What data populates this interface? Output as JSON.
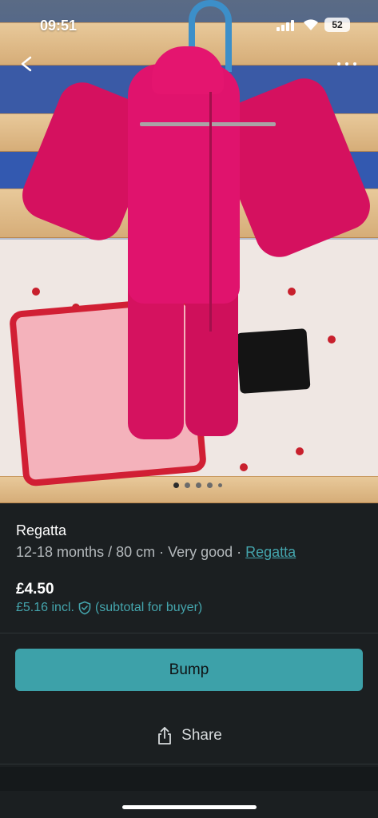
{
  "status_bar": {
    "time": "09:51",
    "battery": "52"
  },
  "photo": {
    "carousel_pages": 5,
    "active_page": 0
  },
  "item": {
    "title": "Regatta",
    "size_condition": "12-18 months / 80 cm · Very good · ",
    "brand_link": "Regatta",
    "price": "£4.50",
    "price_incl": "£5.16 incl.",
    "price_incl_note": "(subtotal for buyer)"
  },
  "actions": {
    "bump_label": "Bump",
    "share_label": "Share"
  },
  "icons": {
    "back": "back-arrow-icon",
    "more": "more-options-icon",
    "shield": "buyer-protection-shield-icon",
    "share": "share-icon"
  },
  "colors": {
    "accent": "#3da1a9",
    "link": "#44a5ad",
    "background": "#1b1f21"
  }
}
